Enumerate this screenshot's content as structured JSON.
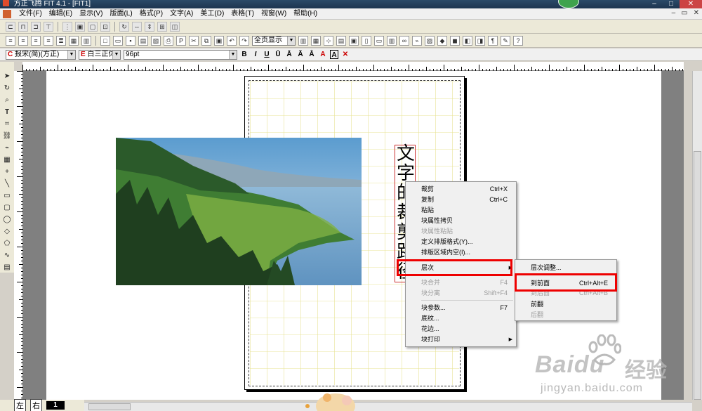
{
  "window": {
    "title": "方正飞腾 FIT 4.1 - [FIT1]"
  },
  "menubar": {
    "items": [
      "文件(F)",
      "编辑(E)",
      "显示(V)",
      "版面(L)",
      "格式(P)",
      "文字(A)",
      "美工(D)",
      "表格(T)",
      "视窗(W)",
      "帮助(H)"
    ]
  },
  "toolbar2": {
    "zoom": "全页显示"
  },
  "toolbar3": {
    "font_cn": "报宋(简)(方正)",
    "font_en": "白三正体",
    "size": "96pt",
    "bold": "B",
    "italic": "I",
    "underline": "U",
    "a_btn": "A"
  },
  "vertical_text": "文字的裁剪路径",
  "context_menu": {
    "items": [
      {
        "label": "裁剪",
        "shortcut": "Ctrl+X",
        "disabled": false
      },
      {
        "label": "复制",
        "shortcut": "Ctrl+C",
        "disabled": false
      },
      {
        "label": "粘贴",
        "shortcut": "",
        "disabled": false
      },
      {
        "label": "块属性拷贝",
        "shortcut": "",
        "disabled": false
      },
      {
        "label": "块属性粘贴",
        "shortcut": "",
        "disabled": true
      },
      {
        "label": "定义排版格式(Y)...",
        "shortcut": "",
        "disabled": false
      },
      {
        "label": "排版区域内空(I)...",
        "shortcut": "",
        "disabled": false
      },
      {
        "label": "层次",
        "shortcut": "",
        "disabled": false
      },
      {
        "label": "块合并",
        "shortcut": "F4",
        "disabled": true
      },
      {
        "label": "块分离",
        "shortcut": "Shift+F4",
        "disabled": true
      },
      {
        "label": "块参数...",
        "shortcut": "F7",
        "disabled": false
      },
      {
        "label": "底纹...",
        "shortcut": "",
        "disabled": false
      },
      {
        "label": "花边...",
        "shortcut": "",
        "disabled": false
      },
      {
        "label": "块打印",
        "shortcut": "",
        "disabled": false
      }
    ]
  },
  "submenu": {
    "items": [
      {
        "label": "层次调整...",
        "shortcut": "",
        "disabled": false
      },
      {
        "label": "到前面",
        "shortcut": "Ctrl+Alt+E",
        "disabled": false
      },
      {
        "label": "到后面",
        "shortcut": "Ctrl+Alt+B",
        "disabled": true
      },
      {
        "label": "前翻",
        "shortcut": "",
        "disabled": false
      },
      {
        "label": "后翻",
        "shortcut": "",
        "disabled": true
      }
    ]
  },
  "status": {
    "tab1": "左",
    "tab2": "右",
    "page": "1"
  },
  "watermark": {
    "brand": "Baidu",
    "cn": "经验",
    "url": "jingyan.baidu.com"
  },
  "colors": {
    "highlight": "#e00000",
    "titlebar": "#1d3550",
    "workspace": "#808080"
  }
}
